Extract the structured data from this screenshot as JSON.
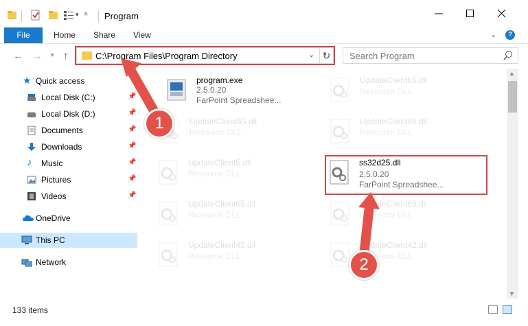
{
  "window": {
    "title": "Program",
    "accent_color": "#1979ca",
    "highlight_color": "#d64545"
  },
  "ribbon": {
    "tabs": [
      "File",
      "Home",
      "Share",
      "View"
    ]
  },
  "address": {
    "path": "C:\\Program Files\\Program Directory",
    "search_placeholder": "Search Program"
  },
  "sidebar": {
    "items": [
      {
        "label": "Quick access",
        "icon": "star-icon"
      },
      {
        "label": "Local Disk (C:)",
        "icon": "drive-icon"
      },
      {
        "label": "Local Disk (D:)",
        "icon": "drive-icon"
      },
      {
        "label": "Documents",
        "icon": "documents-icon"
      },
      {
        "label": "Downloads",
        "icon": "downloads-icon"
      },
      {
        "label": "Music",
        "icon": "music-icon"
      },
      {
        "label": "Pictures",
        "icon": "pictures-icon"
      },
      {
        "label": "Videos",
        "icon": "videos-icon"
      },
      {
        "label": "OneDrive",
        "icon": "cloud-icon"
      },
      {
        "label": "This PC",
        "icon": "computer-icon"
      },
      {
        "label": "Network",
        "icon": "network-icon"
      }
    ]
  },
  "files": [
    {
      "name": "program.exe",
      "line1": "2.5.0.20",
      "line2": "FarPoint Spreadshee..."
    },
    {
      "name": "UpdateClient65.dll",
      "line1": "Resource DLL"
    },
    {
      "name": "UpdateClient65.dll",
      "line1": "Resource DLL"
    },
    {
      "name": "UpdateClient65.dll",
      "line1": "Resource DLL"
    },
    {
      "name": "UpdateClient5.dll",
      "line1": "Resource DLL"
    },
    {
      "name": "ss32d25.dll",
      "line1": "2.5.0.20",
      "line2": "FarPoint Spreadshee..."
    },
    {
      "name": "UpdateClient65.dll",
      "line1": "Resource DLL"
    },
    {
      "name": "UpdateClient65.dll",
      "line1": "Resource DLL"
    },
    {
      "name": "UpdateClient42.dll",
      "line1": "Resource DLL"
    },
    {
      "name": "UpdateClient42.dll",
      "line1": "Resource DLL"
    }
  ],
  "status": {
    "item_count": "133 items"
  },
  "annotations": {
    "badge1": "1",
    "badge2": "2"
  }
}
